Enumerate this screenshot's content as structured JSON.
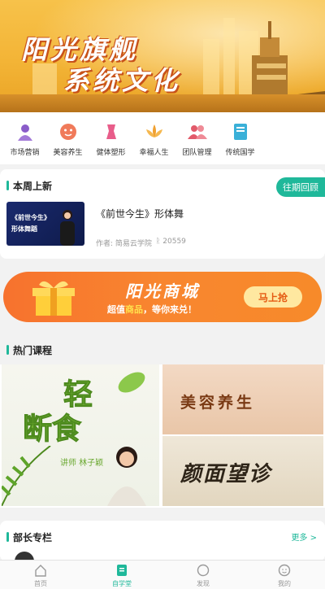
{
  "banner": {
    "line1": "阳光旗舰",
    "line2": "系统文化"
  },
  "categories": [
    {
      "label": "市场营销",
      "icon": "person-icon",
      "color": "#8a5cc9"
    },
    {
      "label": "美容养生",
      "icon": "face-icon",
      "color": "#f07a5a"
    },
    {
      "label": "健体塑形",
      "icon": "body-icon",
      "color": "#e85d8a"
    },
    {
      "label": "幸福人生",
      "icon": "lotus-icon",
      "color": "#f0a030"
    },
    {
      "label": "团队管理",
      "icon": "team-icon",
      "color": "#e25a6a"
    },
    {
      "label": "传统国学",
      "icon": "book-icon",
      "color": "#3ab0d8"
    }
  ],
  "week": {
    "title": "本周上新",
    "past_button": "往期回顾",
    "course": {
      "thumb_line1": "《前世今生》",
      "thumb_line2": "形体舞蹈",
      "title": "《前世今生》形体舞",
      "author": "作者: 简易云学院",
      "views": "20559"
    }
  },
  "mall": {
    "title": "阳光商城",
    "subtitle_prefix": "超值",
    "subtitle_highlight": "商品",
    "subtitle_suffix": "，等你来兑！",
    "cta": "马上抢"
  },
  "hot": {
    "title": "热门课程",
    "left_line1": "轻",
    "left_line2": "断食",
    "teacher": "讲师 林子颖",
    "right1": "美容养生",
    "right2": "颜面望诊"
  },
  "dept": {
    "title": "部长专栏",
    "more": "更多 >"
  },
  "tabs": [
    {
      "label": "首页",
      "icon": "home-icon"
    },
    {
      "label": "自学堂",
      "icon": "study-icon"
    },
    {
      "label": "发现",
      "icon": "discover-icon"
    },
    {
      "label": "我的",
      "icon": "me-icon"
    }
  ],
  "colors": {
    "accent": "#1fb89a",
    "mall": "#f7722e"
  }
}
